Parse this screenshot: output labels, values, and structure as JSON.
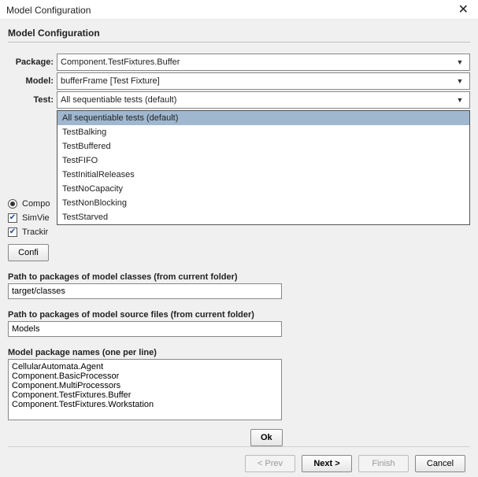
{
  "window": {
    "title": "Model Configuration",
    "subtitle": "Model Configuration"
  },
  "form": {
    "package_label": "Package:",
    "package_value": "Component.TestFixtures.Buffer",
    "model_label": "Model:",
    "model_value": "bufferFrame [Test Fixture]",
    "test_label": "Test:",
    "test_value": "All sequentiable tests (default)",
    "test_options": [
      "All sequentiable tests (default)",
      "TestBalking",
      "TestBuffered",
      "TestFIFO",
      "TestInitialReleases",
      "TestNoCapacity",
      "TestNonBlocking",
      "TestStarved"
    ]
  },
  "options": {
    "compo_label": "Compo",
    "simview_label": "SimVie",
    "tracking_label": "Trackir",
    "config_button": "Confi"
  },
  "paths": {
    "classes_label": "Path to packages of model classes (from current folder)",
    "classes_value": "target/classes",
    "sources_label": "Path to packages of model source files (from current folder)",
    "sources_value": "Models",
    "names_label": "Model package names (one per line)",
    "names_value": "CellularAutomata.Agent\nComponent.BasicProcessor\nComponent.MultiProcessors\nComponent.TestFixtures.Buffer\nComponent.TestFixtures.Workstation"
  },
  "buttons": {
    "ok": "Ok",
    "prev": "< Prev",
    "next": "Next >",
    "finish": "Finish",
    "cancel": "Cancel"
  }
}
